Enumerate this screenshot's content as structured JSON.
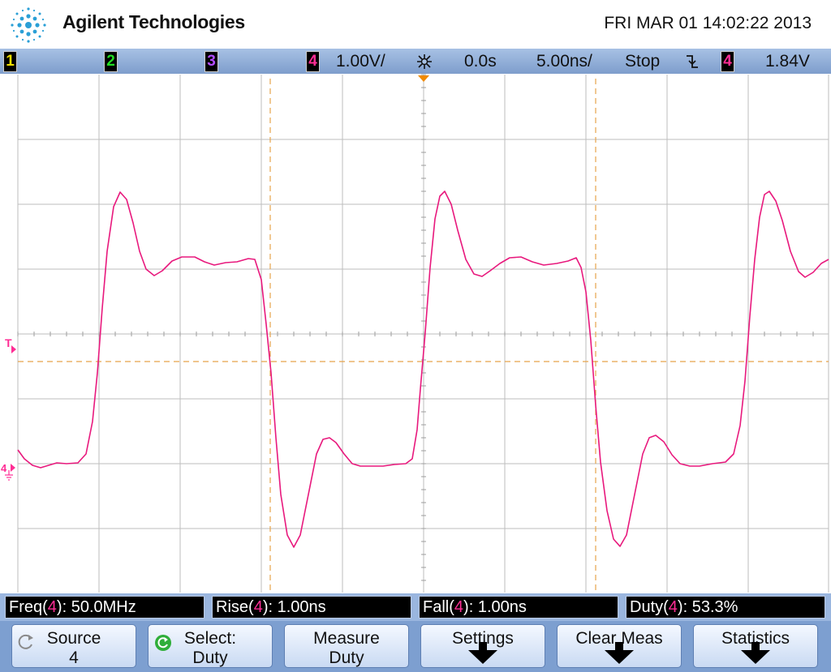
{
  "header": {
    "brand": "Agilent Technologies",
    "datetime": "FRI MAR 01 14:02:22 2013",
    "logo_icon": "agilent-spark-icon"
  },
  "status": {
    "channels": [
      {
        "label": "1",
        "color": "#f0e000"
      },
      {
        "label": "2",
        "color": "#22dd22"
      },
      {
        "label": "3",
        "color": "#b24dff"
      },
      {
        "label": "4",
        "color": "#ff2d95"
      }
    ],
    "ch4_scale": "1.00V/",
    "time_ref_icon": "time-reference-icon",
    "delay": "0.0s",
    "timebase": "5.00ns/",
    "run_state": "Stop",
    "trigger_slope_icon": "falling-edge-icon",
    "trigger_channel": "4",
    "trigger_level": "1.84V"
  },
  "screen": {
    "trigger_marker": "T",
    "ground_marker": "4",
    "trace_color": "#e8197d",
    "cursor_color": "#e6a34b"
  },
  "measurements": [
    {
      "name": "Freq",
      "ch": "4",
      "value": ": 50.0MHz"
    },
    {
      "name": "Rise",
      "ch": "4",
      "value": ": 1.00ns"
    },
    {
      "name": "Fall",
      "ch": "4",
      "value": ": 1.00ns"
    },
    {
      "name": "Duty",
      "ch": "4",
      "value": ": 53.3%"
    }
  ],
  "softkeys": [
    {
      "line1": "Source",
      "line2": "4"
    },
    {
      "line1": "Select:",
      "line2": "Duty"
    },
    {
      "line1": "Measure",
      "line2": "Duty"
    },
    {
      "line1": "Settings",
      "line2": ""
    },
    {
      "line1": "Clear Meas",
      "line2": ""
    },
    {
      "line1": "Statistics",
      "line2": ""
    }
  ]
}
